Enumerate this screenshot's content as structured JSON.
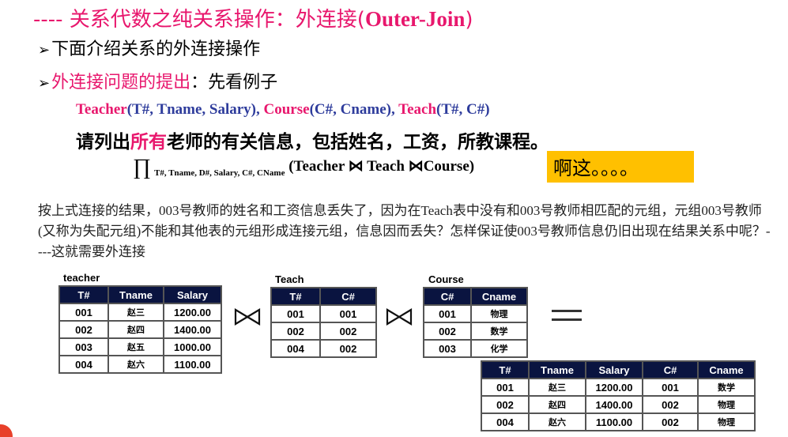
{
  "title": {
    "prefix": "---- 关系代数之纯关系操作：外连接(",
    "latin": "Outer-Join",
    "suffix": ")"
  },
  "bullets": [
    {
      "text": "下面介绍关系的外连接操作"
    },
    {
      "pink": "外连接问题的提出",
      "rest": "：先看例子"
    }
  ],
  "schema": {
    "r1": "Teacher",
    "r1_attrs": "(T#, Tname, Salary), ",
    "r2": "Course",
    "r2_attrs": "(C#, Cname), ",
    "r3": "Teach",
    "r3_attrs": "(T#, C#)"
  },
  "question": {
    "before": "请列出",
    "pink": "所有",
    "after": "老师的有关信息，包括姓名，工资，所教课程。"
  },
  "formula": {
    "pi": "∏",
    "subscript": "T#, Tname, D#, Salary, C#, CName",
    "expr": " (Teacher ⋈ Teach ⋈Course)"
  },
  "highlight": "啊这。。。。",
  "paragraph": "按上式连接的结果，003号教师的姓名和工资信息丢失了，因为在Teach表中没有和003号教师相匹配的元组，元组003号教师(又称为失配元组)不能和其他表的元组形成连接元组，信息因而丢失？怎样保证使003号教师信息仍旧出现在结果关系中呢？----这就需要外连接",
  "tables": {
    "teacher": {
      "caption": "teacher",
      "headers": [
        "T#",
        "Tname",
        "Salary"
      ],
      "rows": [
        [
          "001",
          "赵三",
          "1200.00"
        ],
        [
          "002",
          "赵四",
          "1400.00"
        ],
        [
          "003",
          "赵五",
          "1000.00"
        ],
        [
          "004",
          "赵六",
          "1100.00"
        ]
      ]
    },
    "teach": {
      "caption": "Teach",
      "headers": [
        "T#",
        "C#"
      ],
      "rows": [
        [
          "001",
          "001"
        ],
        [
          "002",
          "002"
        ],
        [
          "004",
          "002"
        ]
      ]
    },
    "course": {
      "caption": "Course",
      "headers": [
        "C#",
        "Cname"
      ],
      "rows": [
        [
          "001",
          "物理"
        ],
        [
          "002",
          "数学"
        ],
        [
          "003",
          "化学"
        ]
      ]
    },
    "result": {
      "headers": [
        "T#",
        "Tname",
        "Salary",
        "C#",
        "Cname"
      ],
      "rows": [
        [
          "001",
          "赵三",
          "1200.00",
          "001",
          "数学"
        ],
        [
          "002",
          "赵四",
          "1400.00",
          "002",
          "物理"
        ],
        [
          "004",
          "赵六",
          "1100.00",
          "002",
          "物理"
        ]
      ]
    }
  },
  "colors": {
    "accent": "#e8176d",
    "schema_blue": "#2e3c9c",
    "table_header": "#0a1440",
    "highlight": "#ffc000"
  }
}
